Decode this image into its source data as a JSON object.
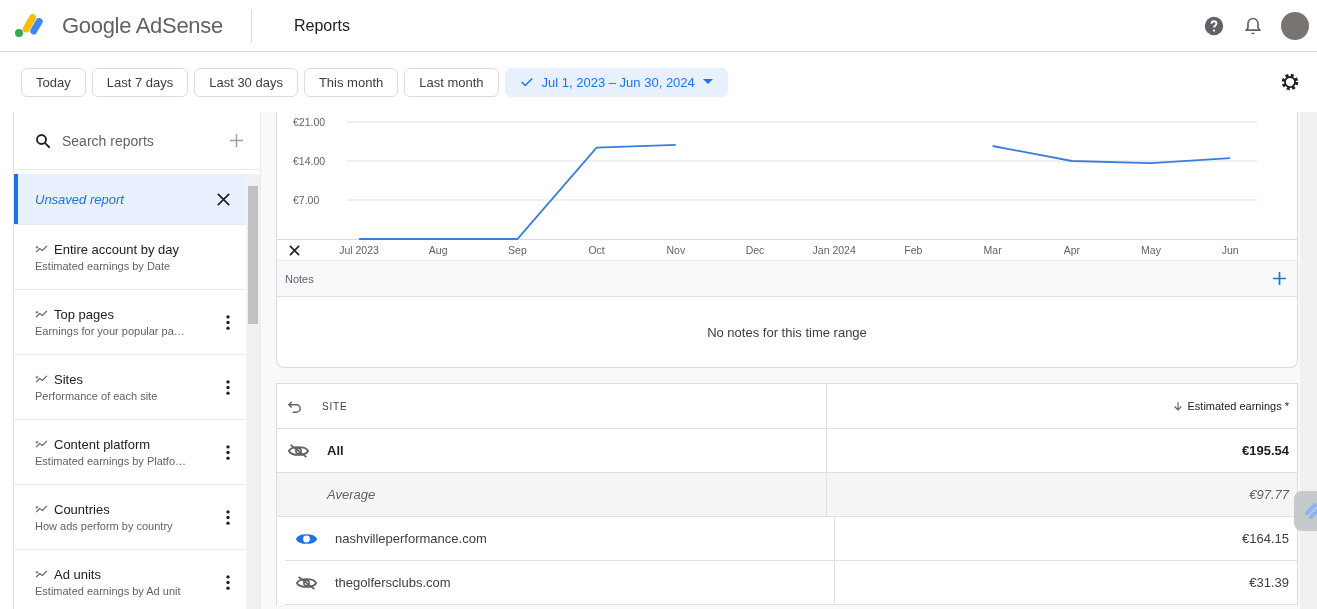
{
  "header": {
    "logo_text": "Google AdSense",
    "page_title": "Reports"
  },
  "date_filters": [
    {
      "label": "Today",
      "selected": false
    },
    {
      "label": "Last 7 days",
      "selected": false
    },
    {
      "label": "Last 30 days",
      "selected": false
    },
    {
      "label": "This month",
      "selected": false
    },
    {
      "label": "Last month",
      "selected": false
    },
    {
      "label": "Jul 1, 2023 – Jun 30, 2024",
      "selected": true
    }
  ],
  "sidebar": {
    "search": {
      "placeholder": "Search reports"
    },
    "items": [
      {
        "kind": "unsaved",
        "title": "Unsaved report",
        "selected": true
      },
      {
        "kind": "report",
        "title": "Entire account by day",
        "subtitle": "Estimated earnings by Date",
        "has_menu": false,
        "selected": false
      },
      {
        "kind": "report",
        "title": "Top pages",
        "subtitle": "Earnings for your popular pa…",
        "has_menu": true,
        "selected": false
      },
      {
        "kind": "report",
        "title": "Sites",
        "subtitle": "Performance of each site",
        "has_menu": true,
        "selected": false
      },
      {
        "kind": "report",
        "title": "Content platform",
        "subtitle": "Estimated earnings by Platfo…",
        "has_menu": true,
        "selected": false
      },
      {
        "kind": "report",
        "title": "Countries",
        "subtitle": "How ads perform by country",
        "has_menu": true,
        "selected": false
      },
      {
        "kind": "report",
        "title": "Ad units",
        "subtitle": "Estimated earnings by Ad unit",
        "has_menu": true,
        "selected": false
      }
    ]
  },
  "chart": {
    "chart_data": {
      "type": "line",
      "categories": [
        "Jul 2023",
        "Aug",
        "Sep",
        "Oct",
        "Nov",
        "Dec",
        "Jan 2024",
        "Feb",
        "Mar",
        "Apr",
        "May",
        "Jun"
      ],
      "series": [
        {
          "color": "#3b7ddd",
          "values": [
            0,
            0,
            0,
            16.4,
            16.9,
            null,
            null,
            null,
            16.7,
            14,
            13.6,
            14.5
          ]
        }
      ],
      "grid": true,
      "ylim": [
        0,
        21
      ],
      "yticks": [
        {
          "value": 7,
          "label": "€7.00"
        },
        {
          "value": 14,
          "label": "€14.00"
        },
        {
          "value": 21,
          "label": "€21.00"
        }
      ]
    }
  },
  "notes": {
    "label": "Notes",
    "empty_text": "No notes for this time range"
  },
  "table": {
    "columns": [
      {
        "label": "SITE"
      },
      {
        "label": "Estimated earnings *",
        "sorted": true
      }
    ],
    "rows": [
      {
        "kind": "total",
        "site": "All",
        "earnings": "€195.54",
        "visible": false
      },
      {
        "kind": "average",
        "site": "Average",
        "earnings": "€97.77"
      },
      {
        "kind": "site",
        "site": "nashvilleperformance.com",
        "earnings": "€164.15",
        "visible": true
      },
      {
        "kind": "site",
        "site": "thegolfersclubs.com",
        "earnings": "€31.39",
        "visible": false
      }
    ]
  }
}
